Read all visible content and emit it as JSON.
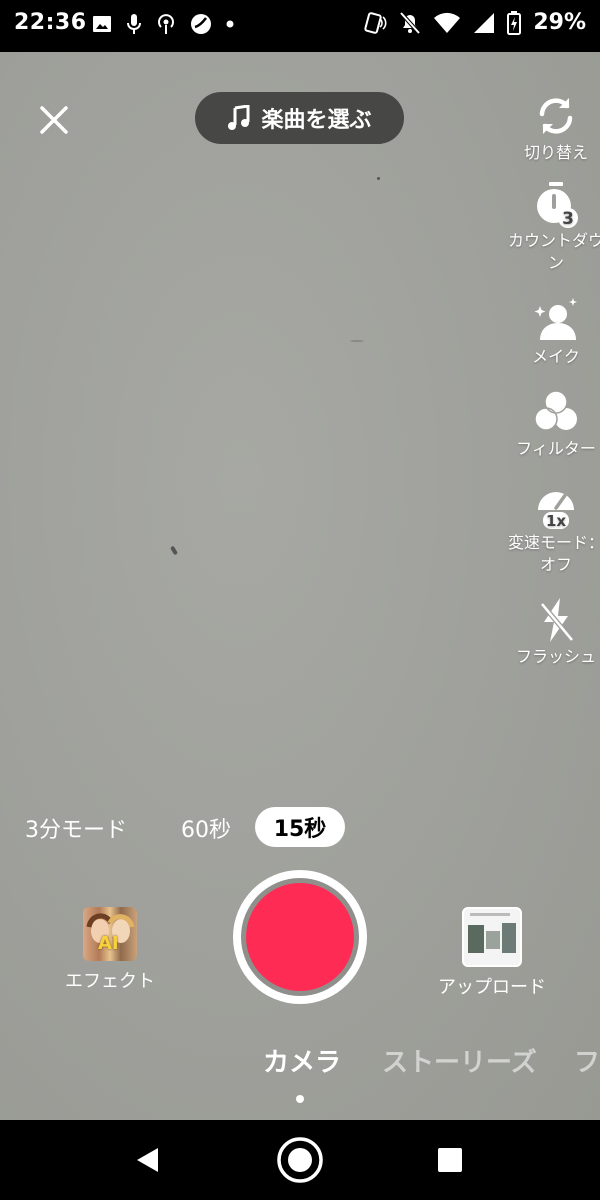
{
  "status_bar": {
    "time": "22:36",
    "battery_percent": "29%",
    "icons": [
      "image-icon",
      "mic-icon",
      "podcast-icon",
      "app-icon",
      "dot-icon",
      "nfc-icon",
      "mute-icon",
      "wifi-icon",
      "signal-icon",
      "battery-icon"
    ]
  },
  "top": {
    "close_icon": "close-icon",
    "music_label": "楽曲を選ぶ"
  },
  "side_tools": [
    {
      "name": "flip",
      "label": "切り替え",
      "icon": "flip-camera-icon"
    },
    {
      "name": "countdown",
      "label": "カウントダウン",
      "icon": "timer-3-icon"
    },
    {
      "name": "makeup",
      "label": "メイク",
      "icon": "beauty-icon"
    },
    {
      "name": "filter",
      "label": "フィルター",
      "icon": "filter-icon"
    },
    {
      "name": "speed",
      "label": "変速モード：オフ",
      "icon": "speed-1x-icon"
    },
    {
      "name": "flash",
      "label": "フラッシュ",
      "icon": "flash-off-icon"
    }
  ],
  "durations": {
    "items": [
      "3分モード",
      "60秒",
      "15秒"
    ],
    "selected": "15秒"
  },
  "bottom": {
    "effect_label": "エフェクト",
    "effect_badge": "AI",
    "upload_label": "アップロード"
  },
  "modes": {
    "items": [
      "カメラ",
      "ストーリーズ",
      "フ"
    ],
    "selected": "カメラ"
  },
  "colors": {
    "record": "#fe2c55",
    "camera_bg": "#a0a19c"
  }
}
